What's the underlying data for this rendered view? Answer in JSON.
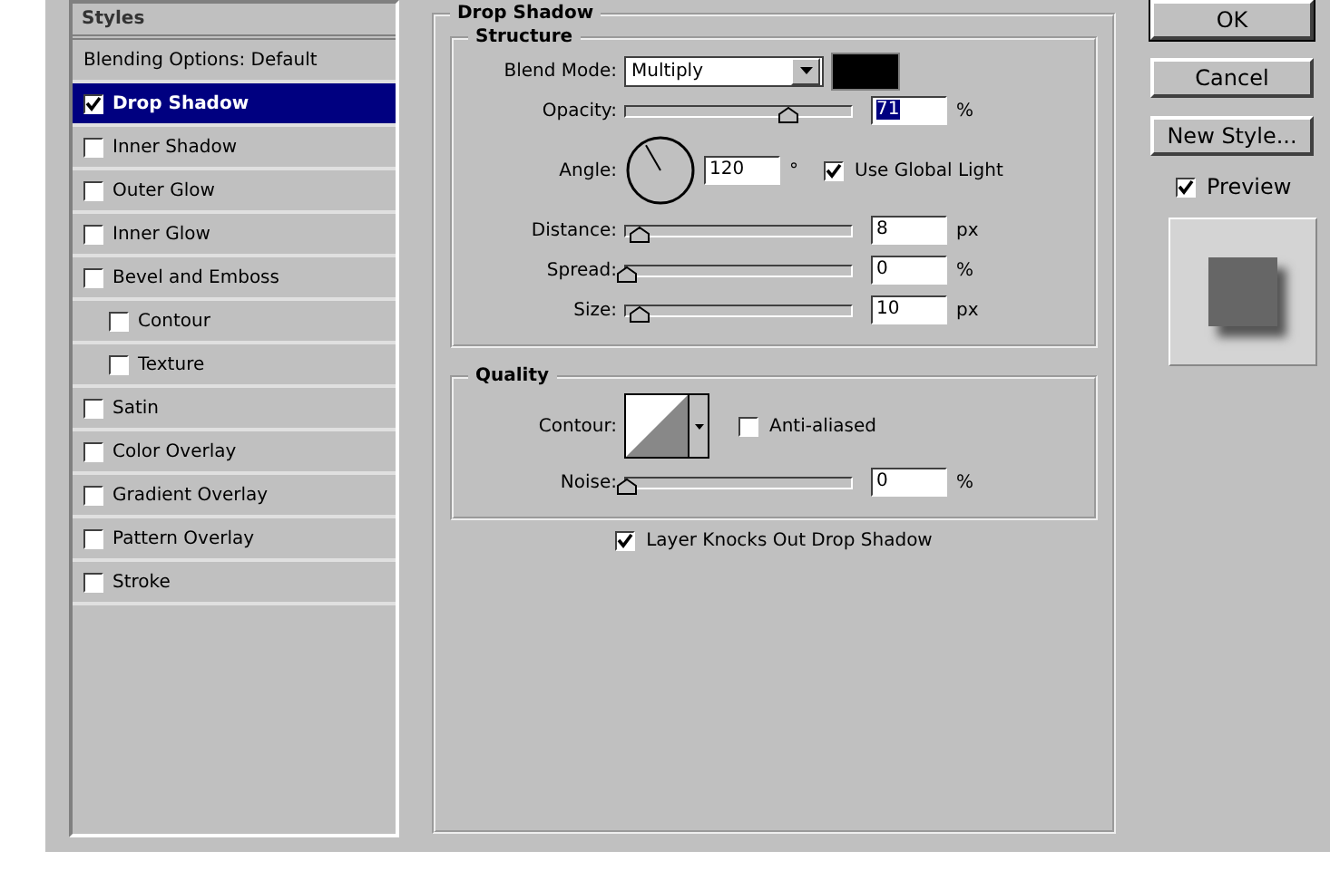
{
  "styles_list": {
    "header": "Styles",
    "items": [
      {
        "label": "Blending Options: Default",
        "kind": "header",
        "selected": false
      },
      {
        "label": "Drop Shadow",
        "kind": "checkbox",
        "checked": true,
        "selected": true
      },
      {
        "label": "Inner Shadow",
        "kind": "checkbox",
        "checked": false,
        "selected": false
      },
      {
        "label": "Outer Glow",
        "kind": "checkbox",
        "checked": false,
        "selected": false
      },
      {
        "label": "Inner Glow",
        "kind": "checkbox",
        "checked": false,
        "selected": false
      },
      {
        "label": "Bevel and Emboss",
        "kind": "checkbox",
        "checked": false,
        "selected": false,
        "children": [
          {
            "label": "Contour",
            "kind": "checkbox",
            "checked": false,
            "selected": false
          },
          {
            "label": "Texture",
            "kind": "checkbox",
            "checked": false,
            "selected": false
          }
        ]
      },
      {
        "label": "Satin",
        "kind": "checkbox",
        "checked": false,
        "selected": false
      },
      {
        "label": "Color Overlay",
        "kind": "checkbox",
        "checked": false,
        "selected": false
      },
      {
        "label": "Gradient Overlay",
        "kind": "checkbox",
        "checked": false,
        "selected": false
      },
      {
        "label": "Pattern Overlay",
        "kind": "checkbox",
        "checked": false,
        "selected": false
      },
      {
        "label": "Stroke",
        "kind": "checkbox",
        "checked": false,
        "selected": false
      }
    ]
  },
  "panel": {
    "title": "Drop Shadow",
    "structure": {
      "title": "Structure",
      "blend_mode": {
        "label": "Blend Mode:",
        "value": "Multiply",
        "color": "#000000"
      },
      "rows": [
        {
          "kind": "slider",
          "label": "Opacity:",
          "level": 0.72,
          "value": "71",
          "value_selected": true,
          "unit": "%"
        },
        {
          "kind": "angle",
          "label": "Angle:",
          "value": "120",
          "unit": "°",
          "checkbox": {
            "label": "Use Global Light",
            "checked": true
          }
        },
        {
          "kind": "slider",
          "label": "Distance:",
          "level": 0.06,
          "value": "8",
          "value_selected": false,
          "unit": "px"
        },
        {
          "kind": "slider",
          "label": "Spread:",
          "level": 0,
          "value": "0",
          "value_selected": false,
          "unit": "%"
        },
        {
          "kind": "slider",
          "label": "Size:",
          "level": 0.06,
          "value": "10",
          "value_selected": false,
          "unit": "px"
        }
      ]
    },
    "quality": {
      "title": "Quality",
      "contour": {
        "label": "Contour:",
        "checkbox": {
          "label": "Anti-aliased",
          "checked": false
        }
      },
      "rows": [
        {
          "kind": "slider",
          "label": "Noise:",
          "level": 0,
          "value": "0",
          "value_selected": false,
          "unit": "%"
        }
      ]
    },
    "knockout": {
      "label": "Layer Knocks Out Drop Shadow",
      "checked": true
    }
  },
  "buttons": [
    {
      "label": "OK",
      "default": true
    },
    {
      "label": "Cancel",
      "default": false
    },
    {
      "label": "New Style...",
      "default": false
    }
  ],
  "preview": {
    "label": "Preview",
    "checked": true
  }
}
